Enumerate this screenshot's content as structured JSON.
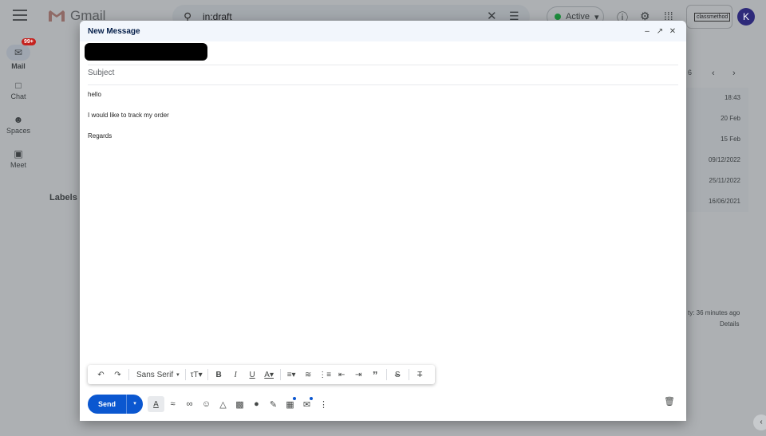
{
  "app": {
    "name": "Gmail",
    "search": {
      "value": "in:draft"
    },
    "status": {
      "label": "Active"
    },
    "org_label": "classmethod",
    "avatar_letter": "K",
    "mail_badge": "99+",
    "nav": [
      {
        "label": "Mail"
      },
      {
        "label": "Chat"
      },
      {
        "label": "Spaces"
      },
      {
        "label": "Meet"
      }
    ],
    "labels_heading": "Labels",
    "pager_text": "6",
    "row_dates": [
      "18:43",
      "20 Feb",
      "15 Feb",
      "09/12/2022",
      "25/11/2022",
      "16/06/2021"
    ],
    "activity_text": "ty: 36 minutes ago",
    "details_link": "Details"
  },
  "compose": {
    "title": "New Message",
    "subject_placeholder": "Subject",
    "body_lines": [
      "hello",
      "I would like to track my order",
      "Regards"
    ],
    "font_label": "Sans Serif",
    "send_label": "Send"
  }
}
